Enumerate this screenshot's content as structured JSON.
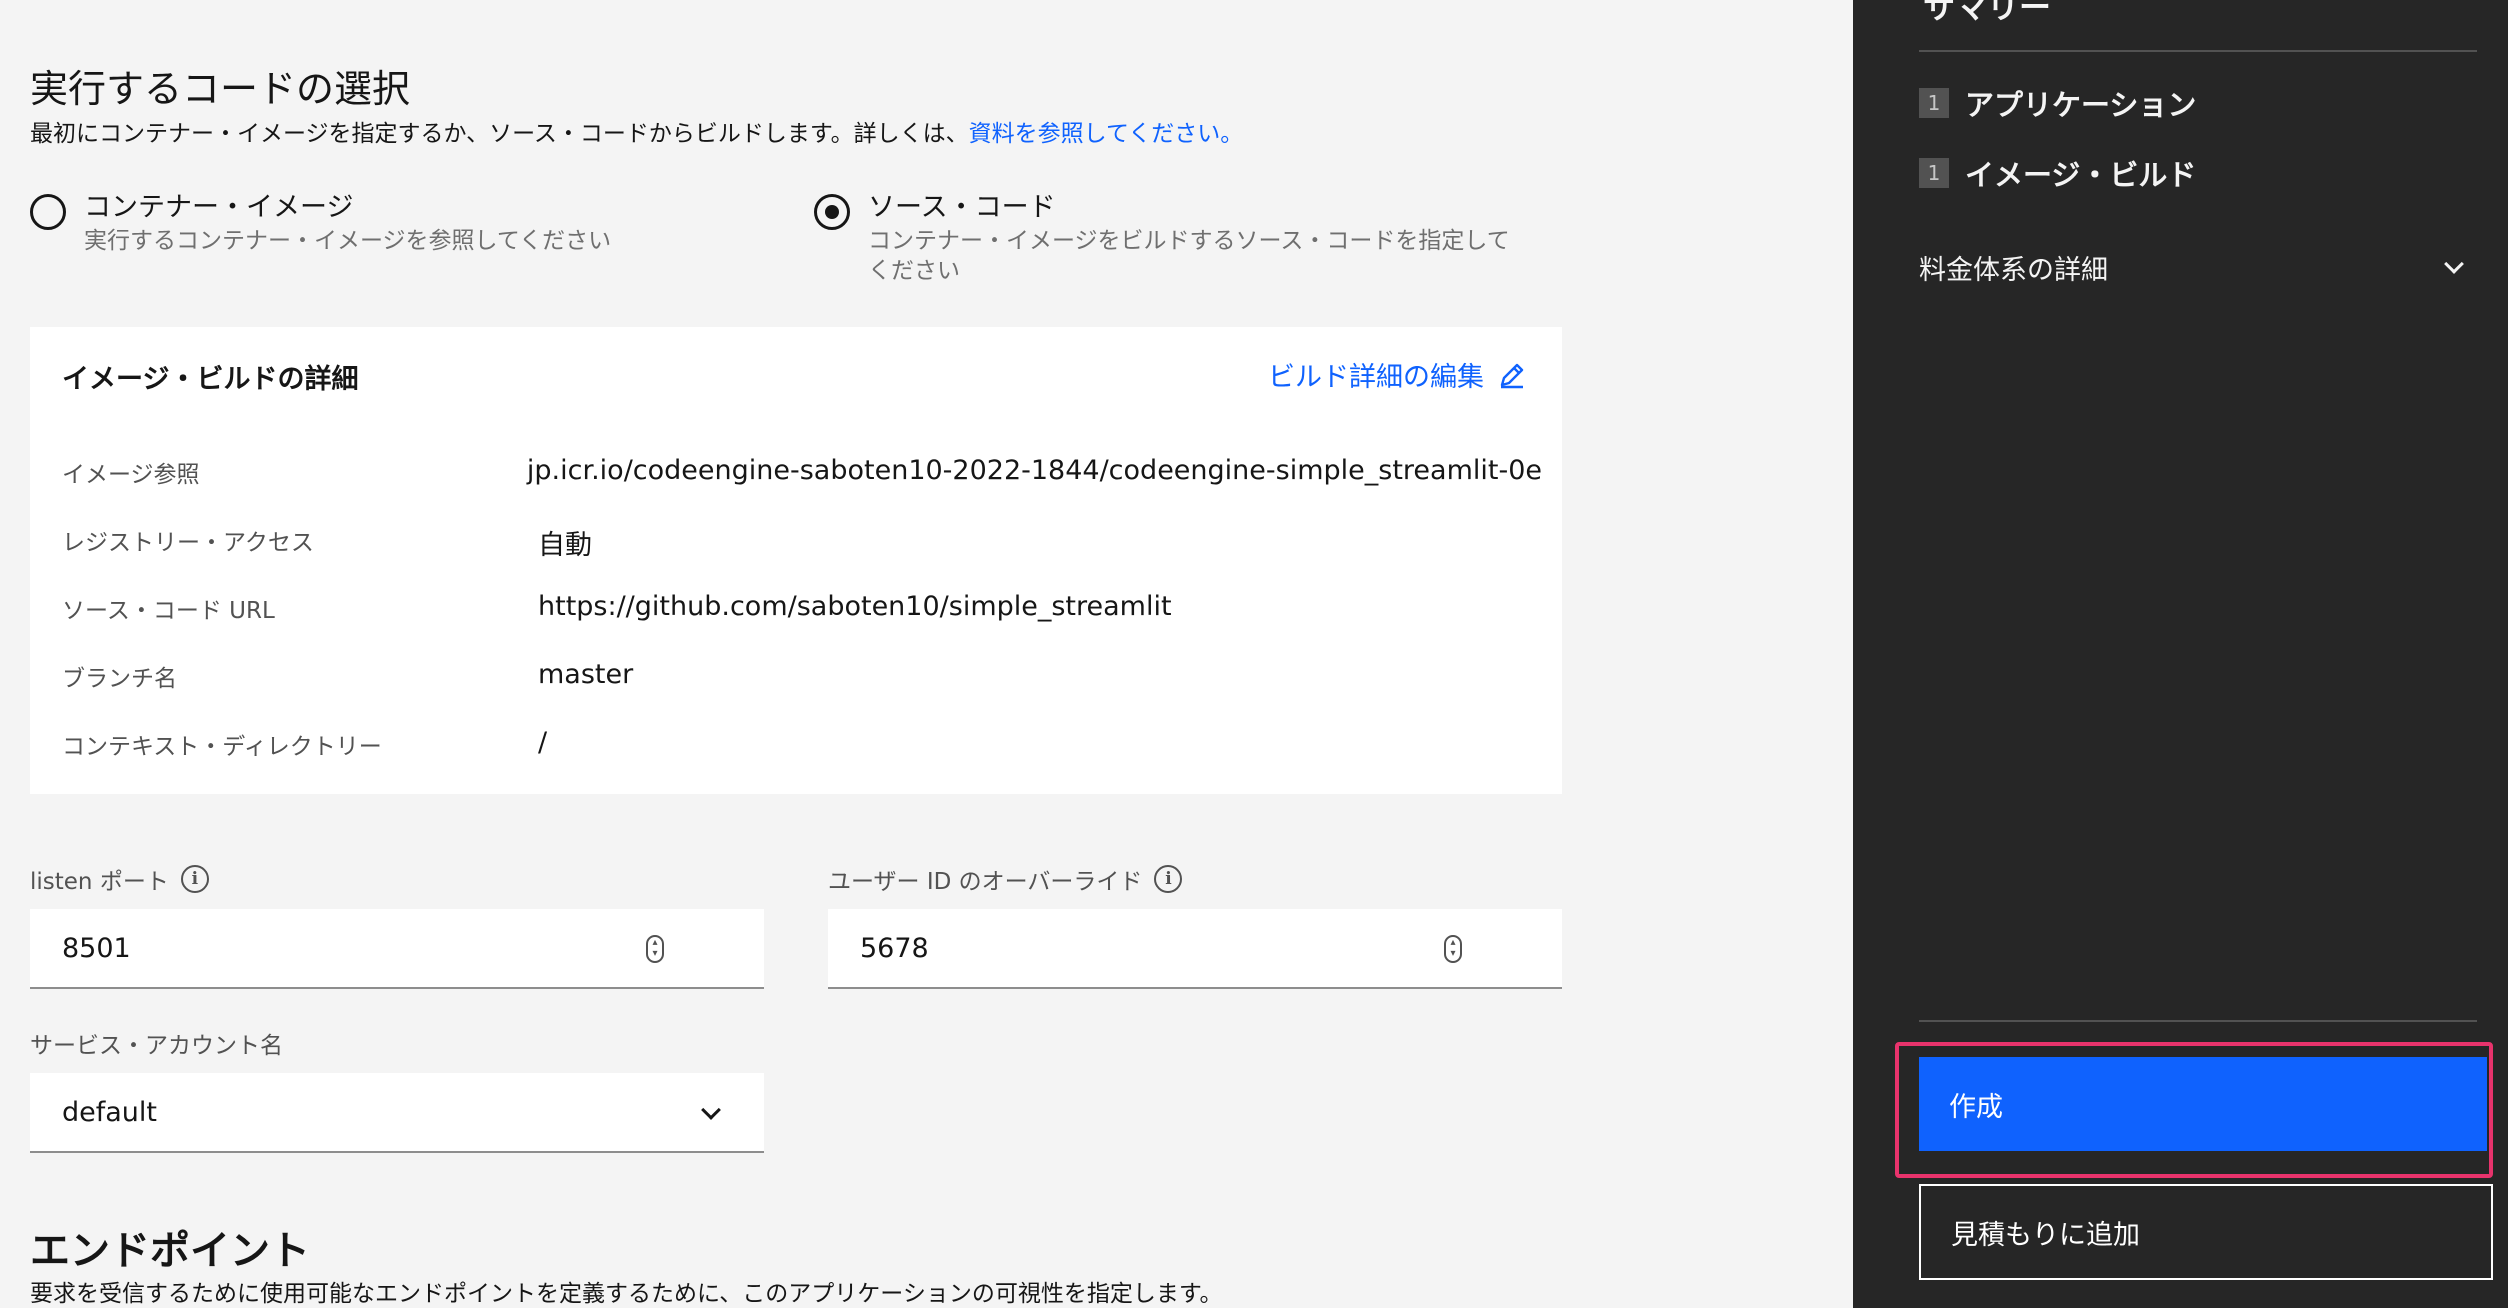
{
  "section": {
    "title": "実行するコードの選択",
    "intro_text": "最初にコンテナー・イメージを指定するか、ソース・コードからビルドします。詳しくは、",
    "intro_link": "資料を参照してください。"
  },
  "source_options": [
    {
      "label": "コンテナー・イメージ",
      "help": "実行するコンテナー・イメージを参照してください",
      "selected": false
    },
    {
      "label": "ソース・コード",
      "help_line1": "コンテナー・イメージをビルドするソース・コードを指定して",
      "help_line2": "ください",
      "selected": true
    }
  ],
  "build_details": {
    "title": "イメージ・ビルドの詳細",
    "edit_label": "ビルド詳細の編集",
    "edit_icon": "pencil-icon",
    "rows": [
      {
        "key": "イメージ参照",
        "value": "jp.icr.io/codeengine-saboten10-2022-1844/codeengine-simple_streamlit-0e"
      },
      {
        "key": "レジストリー・アクセス",
        "value": "自動"
      },
      {
        "key": "ソース・コード URL",
        "value": "https://github.com/saboten10/simple_streamlit"
      },
      {
        "key": "ブランチ名",
        "value": "master"
      },
      {
        "key": "コンテキスト・ディレクトリー",
        "value": "/"
      }
    ]
  },
  "fields": {
    "listen_port": {
      "label": "listen ポート",
      "value": "8501"
    },
    "user_id": {
      "label": "ユーザー ID のオーバーライド",
      "value": "5678"
    },
    "service_account": {
      "label": "サービス・アカウント名",
      "value": "default"
    }
  },
  "endpoint": {
    "title": "エンドポイント",
    "description": "要求を受信するために使用可能なエンドポイントを定義するために、このアプリケーションの可視性を指定します。"
  },
  "summary": {
    "title": "サマリー",
    "steps": [
      {
        "num": "1",
        "label": "アプリケーション"
      },
      {
        "num": "1",
        "label": "イメージ・ビルド"
      }
    ],
    "pricing_label": "料金体系の詳細",
    "create_label": "作成",
    "add_estimate_label": "見積もりに追加"
  },
  "colors": {
    "primary": "#0f62fe",
    "sidebar_bg": "#262626",
    "highlight": "#e8336c",
    "page_bg": "#f4f4f4"
  }
}
